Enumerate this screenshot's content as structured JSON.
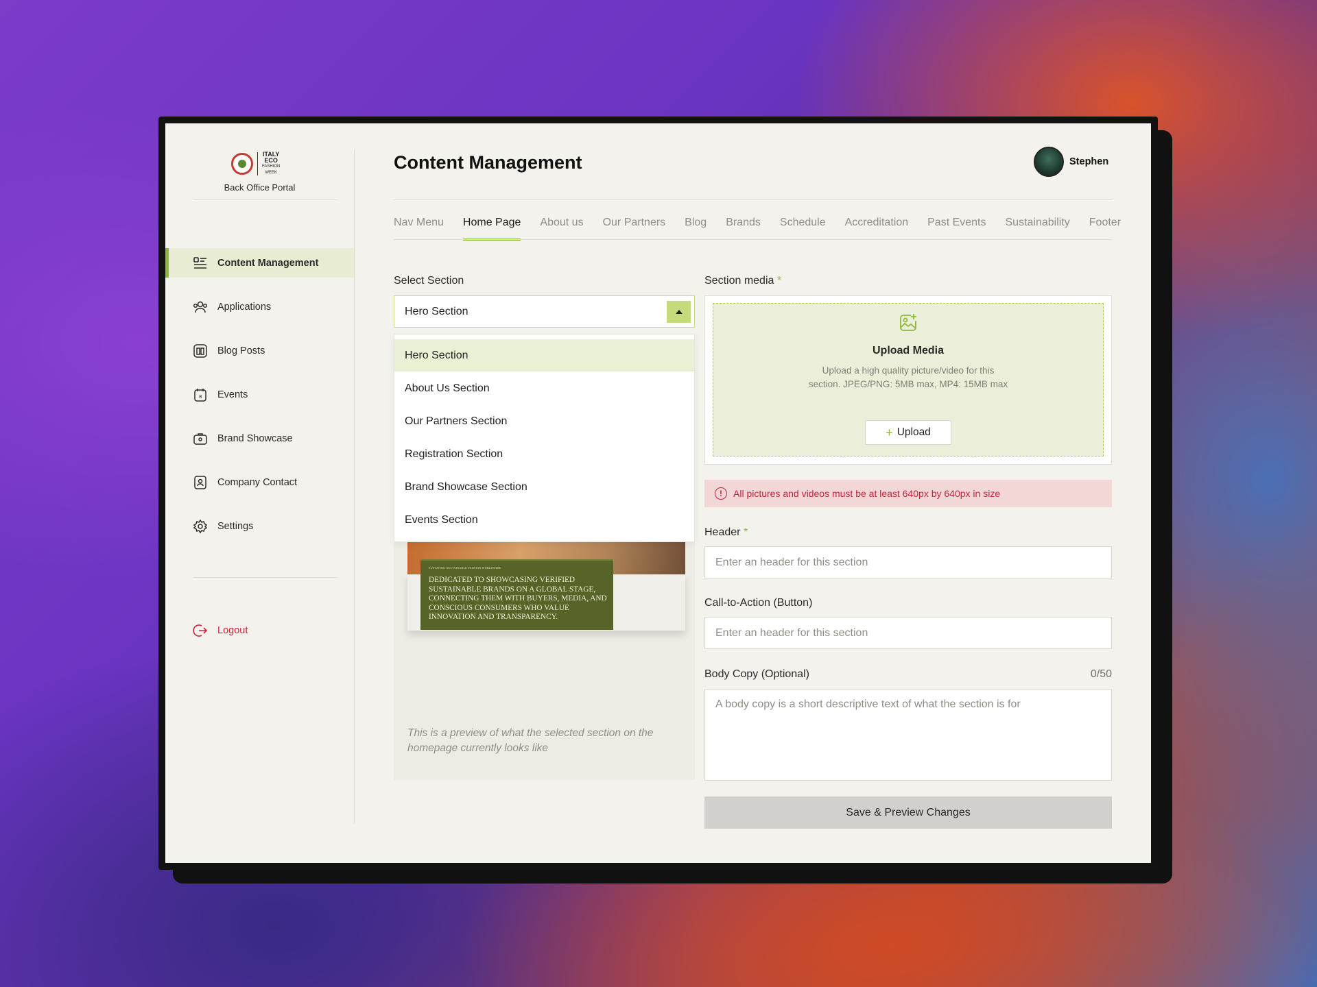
{
  "sidebar": {
    "logo_text": [
      "ITALY",
      "ECO",
      "FASHION",
      "WEEK"
    ],
    "portal_label": "Back Office Portal",
    "items": [
      {
        "label": "Content Management",
        "icon": "list-icon",
        "active": true
      },
      {
        "label": "Applications",
        "icon": "users-icon"
      },
      {
        "label": "Blog Posts",
        "icon": "book-icon"
      },
      {
        "label": "Events",
        "icon": "calendar-icon"
      },
      {
        "label": "Brand Showcase",
        "icon": "briefcase-icon"
      },
      {
        "label": "Company Contact",
        "icon": "contact-icon"
      },
      {
        "label": "Settings",
        "icon": "gear-icon"
      }
    ],
    "logout_label": "Logout"
  },
  "header": {
    "title": "Content Management",
    "user_name": "Stephen"
  },
  "tabs": [
    "Nav Menu",
    "Home Page",
    "About us",
    "Our Partners",
    "Blog",
    "Brands",
    "Schedule",
    "Accreditation",
    "Past Events",
    "Sustainability",
    "Footer"
  ],
  "active_tab": "Home Page",
  "select_section": {
    "label": "Select Section",
    "value": "Hero Section",
    "options": [
      "Hero Section",
      "About Us Section",
      "Our Partners Section",
      "Registration Section",
      "Brand Showcase Section",
      "Events Section"
    ]
  },
  "preview": {
    "small_text": "ELEVATING SUSTAINABLE FASHION WORLDWIDE",
    "headline": "DEDICATED TO SHOWCASING VERIFIED SUSTAINABLE BRANDS ON A GLOBAL STAGE, CONNECTING THEM WITH BUYERS, MEDIA, AND CONSCIOUS CONSUMERS WHO VALUE INNOVATION AND TRANSPARENCY.",
    "caption": "This is a preview of what the selected section on the homepage currently looks like"
  },
  "section_media": {
    "label": "Section media",
    "required_mark": "*",
    "upload_title": "Upload Media",
    "upload_desc": "Upload a high quality picture/video for this section. JPEG/PNG: 5MB max, MP4: 15MB max",
    "upload_button": "Upload"
  },
  "alert": "All pictures and videos must be at least 640px by 640px in size",
  "header_field": {
    "label": "Header",
    "required_mark": "*",
    "placeholder": "Enter an header for this section"
  },
  "cta_field": {
    "label": "Call-to-Action (Button)",
    "placeholder": "Enter an header for this section"
  },
  "body_copy": {
    "label": "Body Copy (Optional)",
    "counter": "0/50",
    "placeholder": "A body copy is a short descriptive text of what the section is for"
  },
  "save_button": "Save & Preview Changes",
  "colors": {
    "accent": "#8fb83a",
    "error": "#c0243b",
    "background": "#f3f2ec"
  }
}
